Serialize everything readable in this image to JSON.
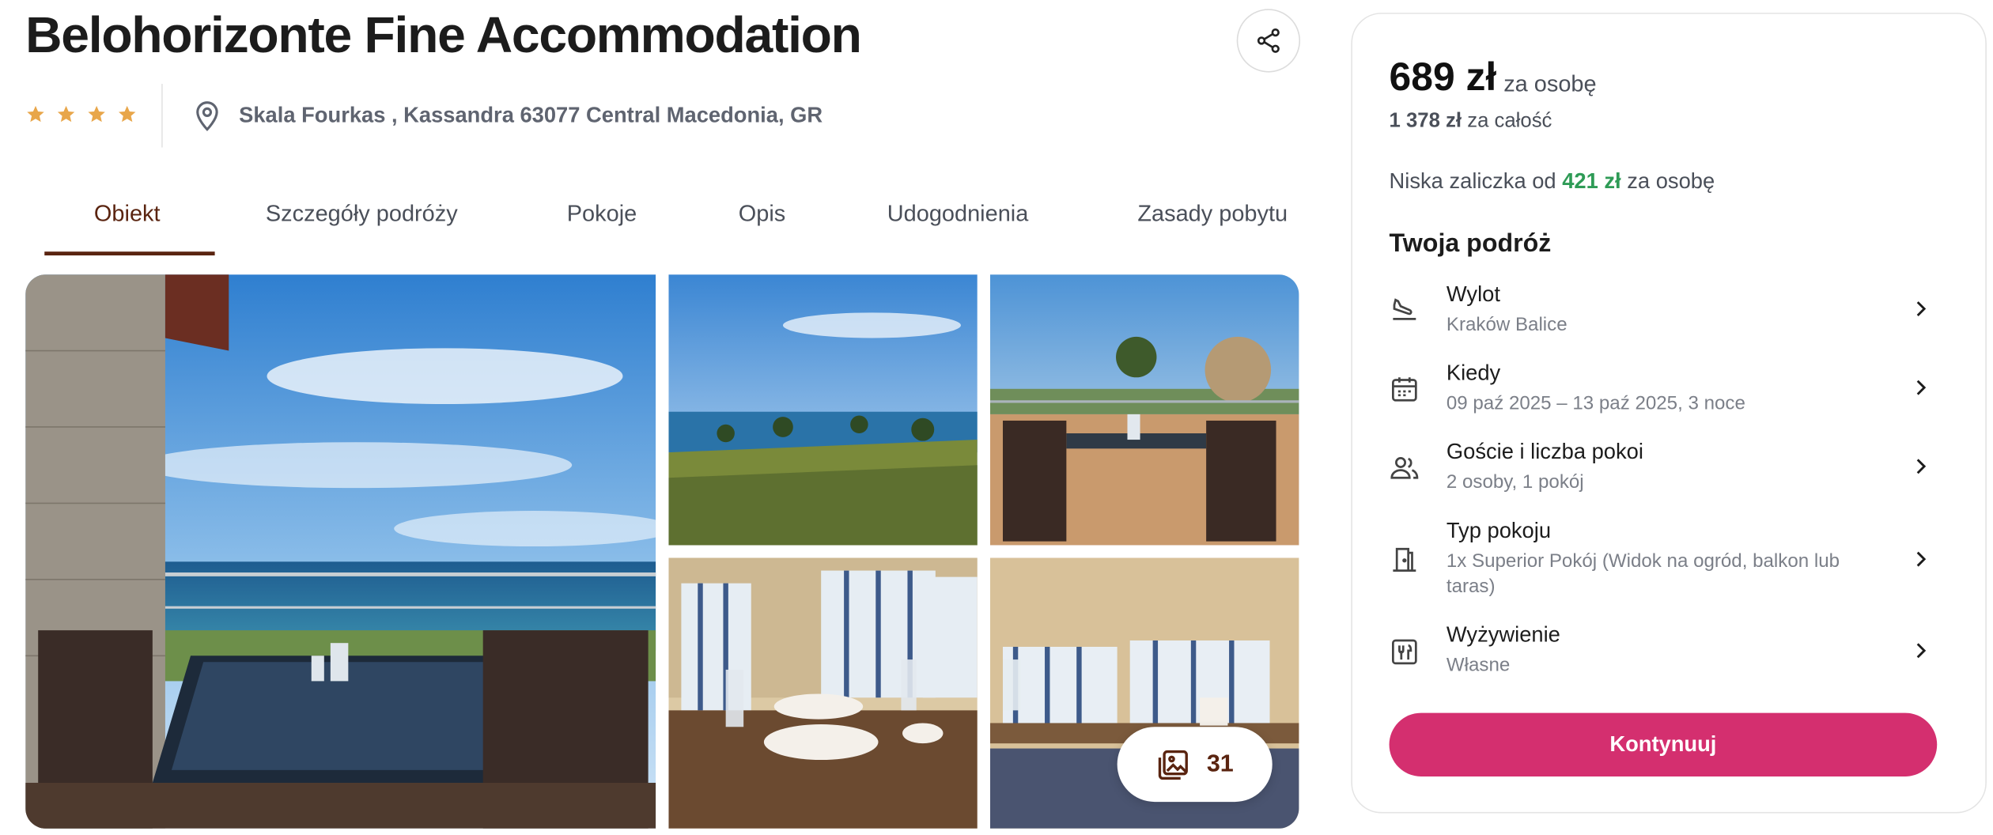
{
  "hotel": {
    "name": "Belohorizonte Fine Accommodation",
    "stars": 4,
    "address": "Skala Fourkas , Kassandra 63077 Central Macedonia, GR"
  },
  "icons": {
    "share": "share-icon",
    "star": "star-icon",
    "location": "location-pin-icon",
    "gallery": "gallery-icon",
    "flight": "plane-landing-icon",
    "calendar": "calendar-icon",
    "guests": "people-icon",
    "room": "door-icon",
    "meals": "fork-knife-icon",
    "chevron": "chevron-right-icon"
  },
  "tabs": [
    {
      "label": "Obiekt",
      "active": true
    },
    {
      "label": "Szczegóły podróży"
    },
    {
      "label": "Pokoje"
    },
    {
      "label": "Opis"
    },
    {
      "label": "Udogodnienia"
    },
    {
      "label": "Zasady pobytu"
    }
  ],
  "gallery": {
    "count": "31"
  },
  "booking": {
    "price": "689 zł",
    "price_unit": "za osobę",
    "total_amount": "1 378 zł",
    "total_label": "za całość",
    "deposit_prefix": "Niska zaliczka od",
    "deposit_amount": "421 zł",
    "deposit_suffix": "za osobę",
    "trip_heading": "Twoja podróż",
    "rows": [
      {
        "title": "Wylot",
        "value": "Kraków Balice"
      },
      {
        "title": "Kiedy",
        "value": "09 paź 2025 – 13 paź 2025, 3 noce"
      },
      {
        "title": "Goście i liczba pokoi",
        "value": "2 osoby, 1 pokój"
      },
      {
        "title": "Typ pokoju",
        "value": "1x Superior Pokój (Widok na ogród, balkon lub taras)"
      },
      {
        "title": "Wyżywienie",
        "value": "Własne"
      }
    ],
    "cta": "Kontynuuj"
  },
  "colors": {
    "accent_brown": "#5a2410",
    "cta_pink": "#d42f6f",
    "deposit_green": "#2e9b56",
    "star_gold": "#e8a64a"
  }
}
